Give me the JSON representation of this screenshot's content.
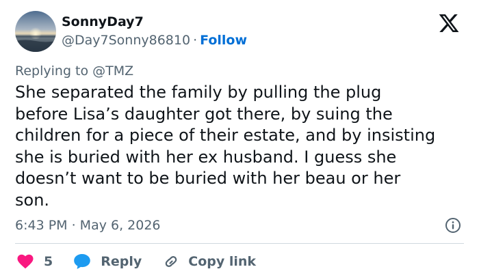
{
  "author": {
    "display_name": "SonnyDay7",
    "handle": "@Day7Sonny86810",
    "separator": "·",
    "follow_label": "Follow"
  },
  "reply_context": {
    "text": "Replying to @TMZ"
  },
  "tweet": {
    "text": "She separated the family by pulling the plug\nbefore Lisa’s daughter got there, by suing the\nchildren for a piece of their estate, and by insisting\nshe is buried with her ex husband. I guess she\ndoesn’t want to be buried with her beau or her\nson.",
    "timestamp": "6:43 PM · May 6, 2026"
  },
  "actions": {
    "like_count": "5",
    "reply_label": "Reply",
    "copy_label": "Copy link"
  },
  "icons": {
    "logo": "x-logo-icon",
    "info": "info-icon",
    "like": "heart-icon",
    "reply": "speech-bubble-icon",
    "copy": "link-icon"
  },
  "colors": {
    "text_primary": "#0f1419",
    "text_secondary": "#536471",
    "accent": "#006fd6",
    "like": "#f91880",
    "reply": "#1d9bf0",
    "divider": "#cfd9de"
  }
}
